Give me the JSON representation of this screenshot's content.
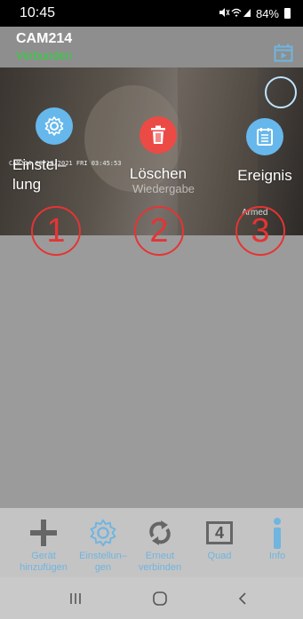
{
  "status_bar": {
    "time": "10:45",
    "battery": "84%",
    "icons": "sound-off-icon wifi-icon signal-icon battery-icon"
  },
  "camera": {
    "name": "CAM214",
    "status": "Verbunden",
    "status_color": "#2bd43b"
  },
  "video": {
    "osd_text": "CAM214 08/18/2021 FRI 03:45:53",
    "armed_label": "Armed",
    "watermark": "Wiedergabe"
  },
  "actions": [
    {
      "label": "Einstel–\nlung",
      "icon": "gear-icon",
      "color": "#66b8ec"
    },
    {
      "label": "Löschen",
      "icon": "trash-icon",
      "color": "#ec4a45"
    },
    {
      "label": "Ereignis",
      "icon": "calendar-list-icon",
      "color": "#66b8ec"
    }
  ],
  "numbers": [
    "1",
    "2",
    "3"
  ],
  "toolbar": {
    "items": [
      {
        "label": "Gerät\nhinzufügen",
        "icon": "plus-icon"
      },
      {
        "label": "Einstellun–\ngen",
        "icon": "gear-icon"
      },
      {
        "label": "Erneut\nverbinden",
        "icon": "refresh-icon"
      },
      {
        "label": "Quad",
        "icon": "quad-icon",
        "value": "4"
      },
      {
        "label": "Info",
        "icon": "info-icon"
      }
    ],
    "accent_color": "#6fb5e0"
  },
  "nav_bar": {
    "buttons": [
      "recent-apps-icon",
      "home-icon",
      "back-icon"
    ]
  }
}
